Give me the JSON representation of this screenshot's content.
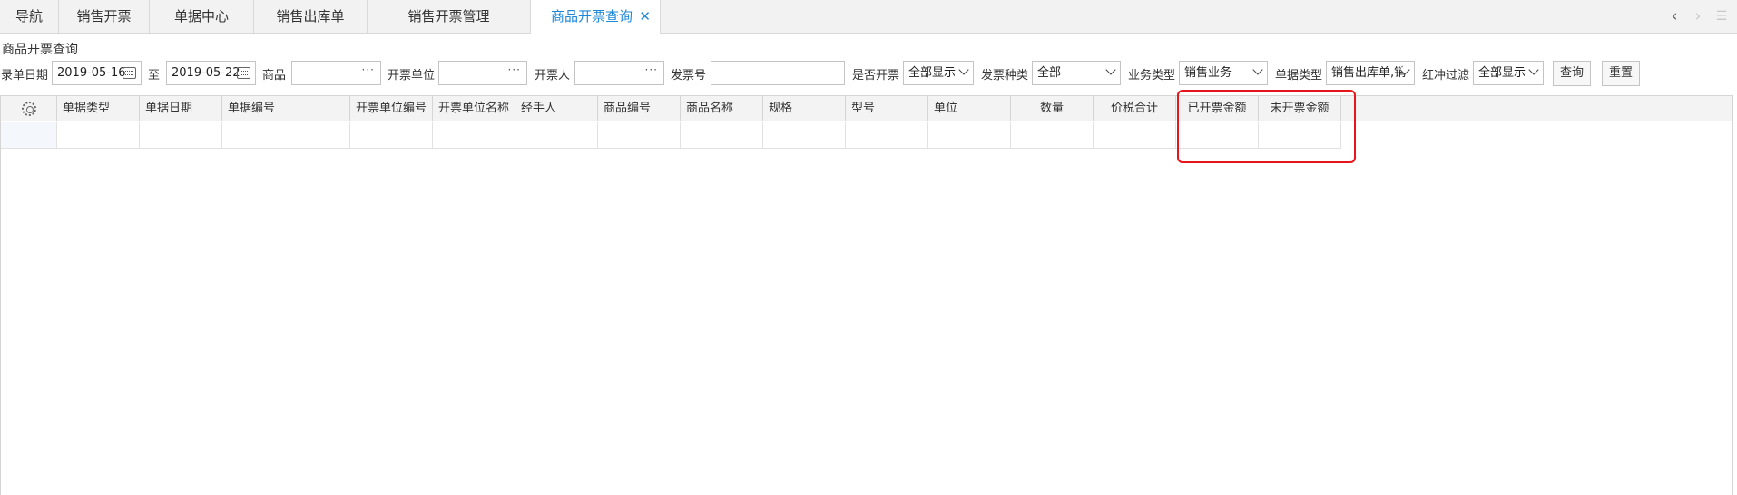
{
  "tabs": [
    {
      "label": "导航"
    },
    {
      "label": "销售开票"
    },
    {
      "label": "单据中心"
    },
    {
      "label": "销售出库单"
    },
    {
      "label": "销售开票管理"
    },
    {
      "label": "商品开票查询",
      "close": "✕"
    }
  ],
  "tab_nav": {
    "prev": "‹",
    "next": "›",
    "menu": "☰"
  },
  "page_title": "商品开票查询",
  "filters": {
    "entry_date_label": "录单日期",
    "date_from": "2019-05-16",
    "date_sep": "至",
    "date_to": "2019-05-22",
    "product_label": "商品",
    "product_value": "",
    "invoice_unit_label": "开票单位",
    "invoice_unit_value": "",
    "invoicer_label": "开票人",
    "invoicer_value": "",
    "invoice_no_label": "发票号",
    "invoice_no_value": "",
    "is_invoiced_label": "是否开票",
    "is_invoiced_value": "全部显示",
    "invoice_kind_label": "发票种类",
    "invoice_kind_value": "全部",
    "biz_type_label": "业务类型",
    "biz_type_value": "销售业务",
    "doc_type_label": "单据类型",
    "doc_type_value": "销售出库单,销",
    "red_filter_label": "红冲过滤",
    "red_filter_value": "全部显示",
    "query_button": "查询",
    "reset_button": "重置",
    "more_glyph": "···"
  },
  "grid": {
    "columns": [
      {
        "label": "单据类型"
      },
      {
        "label": "单据日期"
      },
      {
        "label": "单据编号"
      },
      {
        "label": "开票单位编号"
      },
      {
        "label": "开票单位名称"
      },
      {
        "label": "经手人"
      },
      {
        "label": "商品编号"
      },
      {
        "label": "商品名称"
      },
      {
        "label": "规格"
      },
      {
        "label": "型号"
      },
      {
        "label": "单位"
      },
      {
        "label": "数量"
      },
      {
        "label": "价税合计"
      },
      {
        "label": "已开票金额"
      },
      {
        "label": "未开票金额"
      }
    ],
    "rows": [
      {
        "cells": [
          "",
          "",
          "",
          "",
          "",
          "",
          "",
          "",
          "",
          "",
          "",
          "",
          "",
          "",
          ""
        ]
      }
    ]
  },
  "colors": {
    "accent": "#1e88d8",
    "highlight": "#e8141c"
  }
}
